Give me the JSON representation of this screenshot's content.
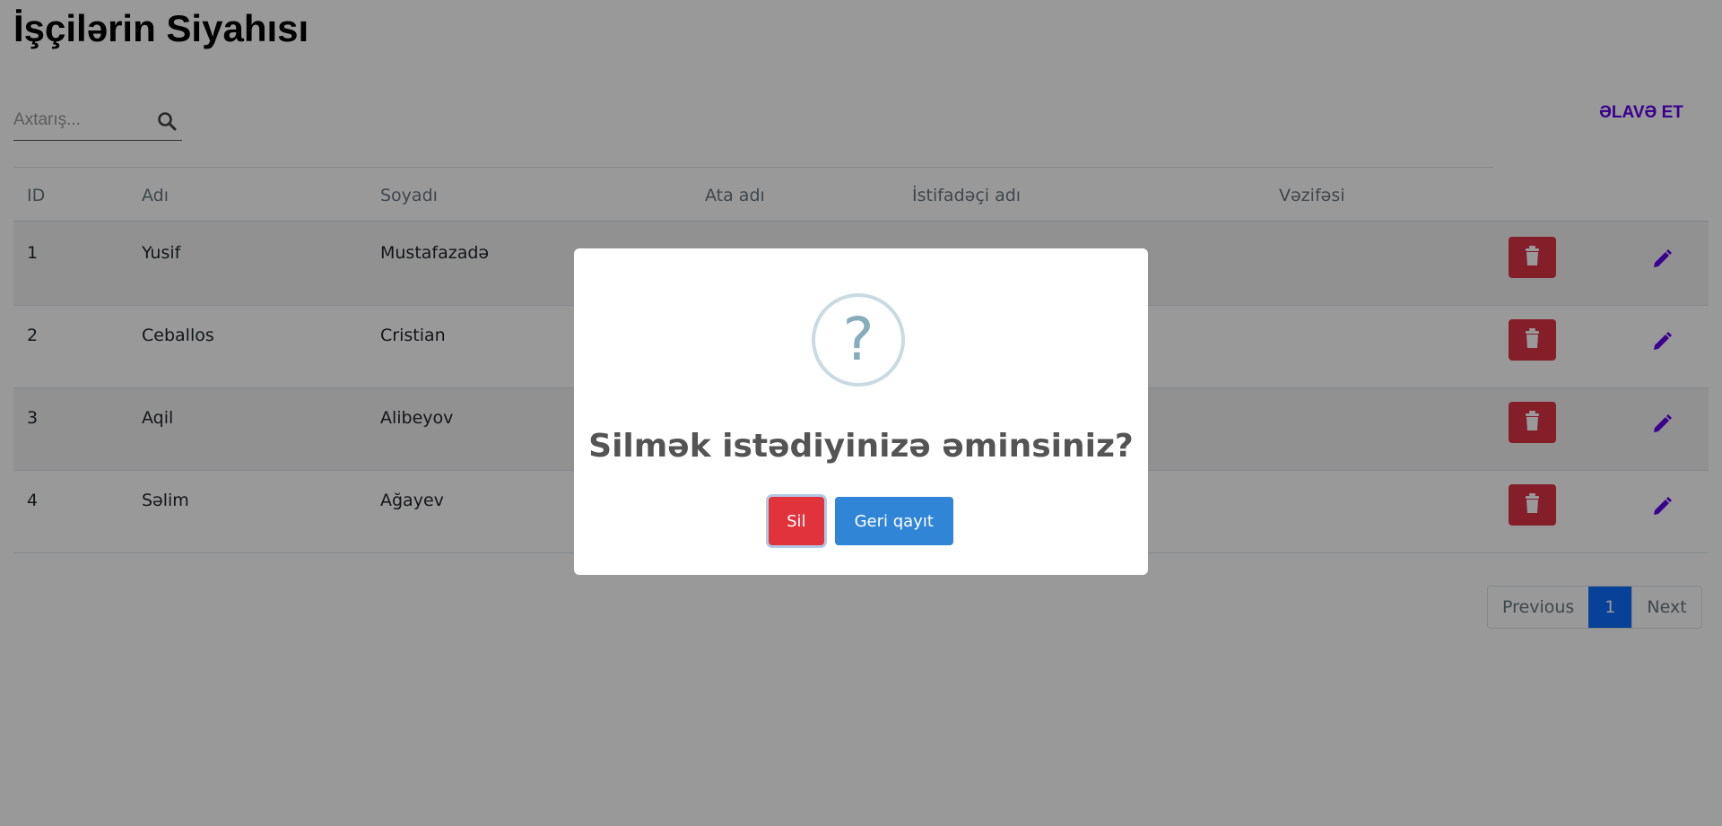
{
  "page": {
    "title": "İşçilərin Siyahısı"
  },
  "search": {
    "placeholder": "Axtarış...",
    "value": ""
  },
  "toolbar": {
    "add_label": "ƏLAVƏ ET"
  },
  "table": {
    "headers": [
      "ID",
      "Adı",
      "Soyadı",
      "Ata adı",
      "İstifadəçi adı",
      "Vəzifəsi"
    ],
    "rows": [
      {
        "id": "1",
        "name": "Yusif",
        "surname": "Mustafazadə",
        "father": "",
        "username": "",
        "position": ""
      },
      {
        "id": "2",
        "name": "Ceballos",
        "surname": "Cristian",
        "father": "",
        "username": "",
        "position": ""
      },
      {
        "id": "3",
        "name": "Aqil",
        "surname": "Alibeyov",
        "father": "",
        "username": "",
        "position": ""
      },
      {
        "id": "4",
        "name": "Səlim",
        "surname": "Ağayev",
        "father": "",
        "username": "",
        "position": ""
      }
    ]
  },
  "pagination": {
    "previous_label": "Previous",
    "current_page": "1",
    "next_label": "Next"
  },
  "modal": {
    "icon_glyph": "?",
    "title": "Silmək istədiyinizə əminsiniz?",
    "confirm_label": "Sil",
    "cancel_label": "Geri qayıt"
  },
  "colors": {
    "accent": "#6200ee",
    "delete": "#dc3545",
    "confirm": "#e0333b",
    "cancel": "#3085d6",
    "active_page": "#0d6efd"
  }
}
